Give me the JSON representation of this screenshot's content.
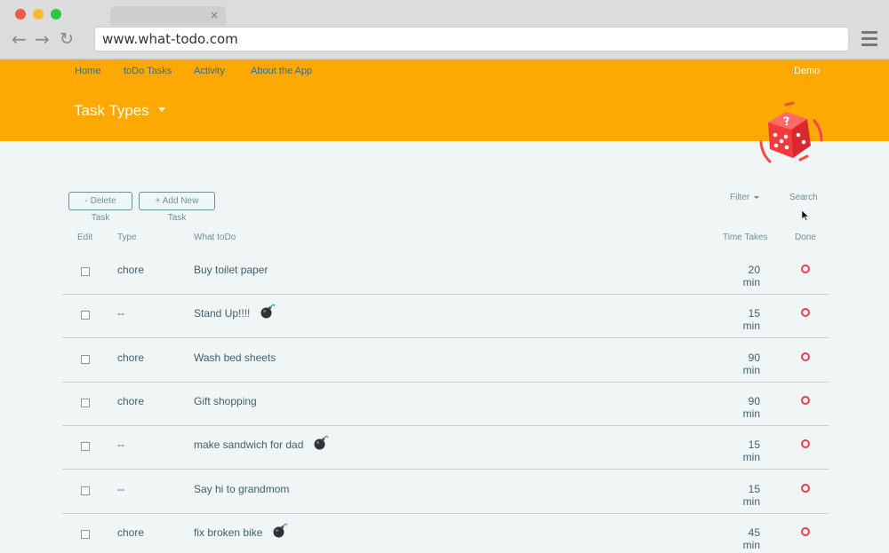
{
  "browser": {
    "url": "www.what-todo.com",
    "tab_close": "×",
    "back": "←",
    "forward": "→",
    "reload": "↻"
  },
  "nav": {
    "home": "Home",
    "tasks": "toDo Tasks",
    "activity": "Activity",
    "about": "About the App",
    "user": "Demo"
  },
  "page": {
    "title": "Task Types"
  },
  "toolbar": {
    "delete_label": "- Delete Task",
    "add_label": "+ Add New Task",
    "filter_label": "Filter",
    "search_label": "Search"
  },
  "columns": {
    "edit": "Edit",
    "type": "Type",
    "what": "What toDo",
    "time": "Time Takes",
    "done": "Done"
  },
  "tasks": [
    {
      "type": "chore",
      "what": "Buy toilet paper",
      "time": "20 min",
      "bomb": false
    },
    {
      "type": "--",
      "what": "Stand Up!!!!",
      "time": "15 min",
      "bomb": true
    },
    {
      "type": "chore",
      "what": "Wash bed sheets",
      "time": "90 min",
      "bomb": false
    },
    {
      "type": "chore",
      "what": "Gift shopping",
      "time": "90 min",
      "bomb": false
    },
    {
      "type": "--",
      "what": "make sandwich for dad",
      "time": "15 min",
      "bomb": true
    },
    {
      "type": "--",
      "what": "Say hi to grandmom",
      "time": "15 min",
      "bomb": false
    },
    {
      "type": "chore",
      "what": "fix broken bike",
      "time": "45 min",
      "bomb": true
    }
  ],
  "colors": {
    "header": "#fea901",
    "content_bg": "#eff6f5",
    "done_ring": "#e94050",
    "text": "#3f5f72"
  },
  "icons": {
    "dice": "dice-question-icon",
    "bomb": "bomb-icon",
    "done": "circle-icon",
    "menu": "hamburger-icon"
  }
}
